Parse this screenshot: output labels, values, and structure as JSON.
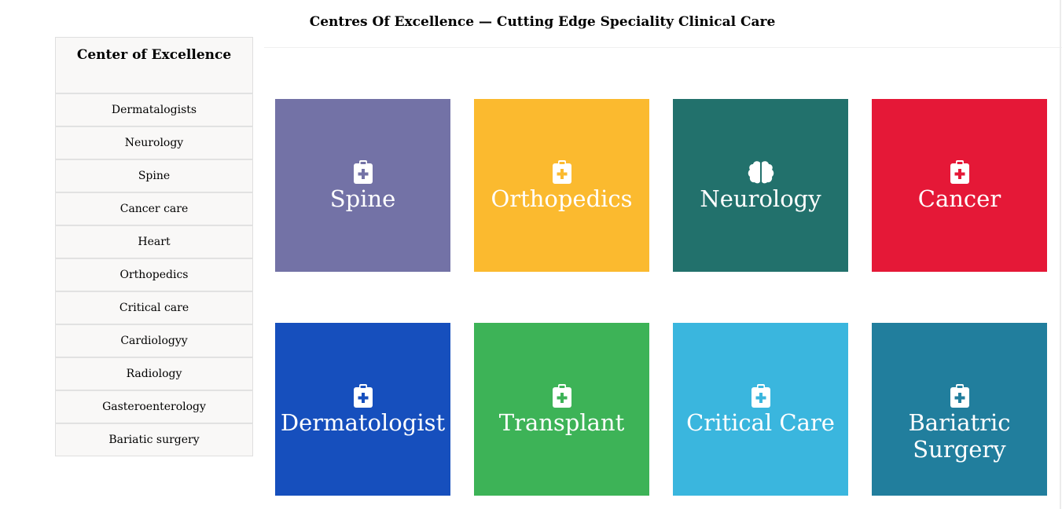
{
  "page": {
    "title": "Centres Of Excellence — Cutting Edge Speciality Clinical Care"
  },
  "sidebar": {
    "header": "Center of Excellence",
    "items": [
      {
        "label": "Dermatalogists"
      },
      {
        "label": "Neurology"
      },
      {
        "label": "Spine"
      },
      {
        "label": "Cancer care"
      },
      {
        "label": "Heart"
      },
      {
        "label": "Orthopedics"
      },
      {
        "label": "Critical care"
      },
      {
        "label": "Cardiologyy"
      },
      {
        "label": "Radiology"
      },
      {
        "label": "Gasteroenterology"
      },
      {
        "label": "Bariatic surgery"
      }
    ]
  },
  "tiles": [
    {
      "label": "Spine",
      "color": "#7372a6",
      "icon": "clipboard-medical-icon"
    },
    {
      "label": "Orthopedics",
      "color": "#fbba2f",
      "icon": "clipboard-medical-icon"
    },
    {
      "label": "Neurology",
      "color": "#22716c",
      "icon": "brain-icon"
    },
    {
      "label": "Cancer",
      "color": "#e51837",
      "icon": "clipboard-medical-icon"
    },
    {
      "label": "Dermatologist",
      "color": "#164fbd",
      "icon": "clipboard-medical-icon"
    },
    {
      "label": "Transplant",
      "color": "#3db357",
      "icon": "clipboard-medical-icon"
    },
    {
      "label": "Critical Care",
      "color": "#3ab6de",
      "icon": "clipboard-medical-icon"
    },
    {
      "label": "Bariatric Surgery",
      "color": "#217e9d",
      "icon": "clipboard-medical-icon"
    }
  ]
}
